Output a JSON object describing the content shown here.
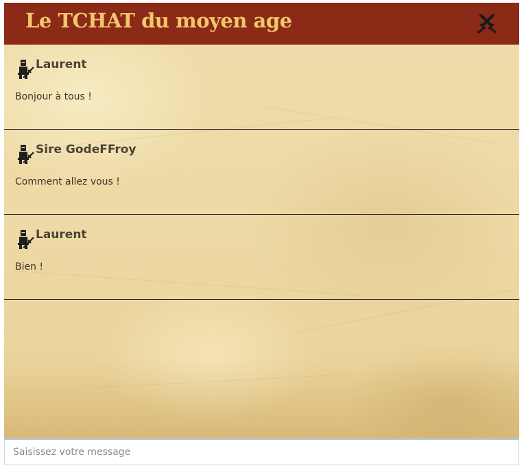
{
  "header": {
    "title": "Le TCHAT du moyen age",
    "icon": "crossed-swords-icon",
    "background": "#8b2a16",
    "title_color": "#f2c66d"
  },
  "messages": [
    {
      "sender": "Laurent",
      "text": "Bonjour à tous !",
      "avatar_icon": "knight-icon"
    },
    {
      "sender": "Sire GodeFFroy",
      "text": "Comment allez vous !",
      "avatar_icon": "knight-icon"
    },
    {
      "sender": "Laurent",
      "text": "Bien !",
      "avatar_icon": "knight-icon"
    }
  ],
  "composer": {
    "placeholder": "Saisissez votre message",
    "value": ""
  }
}
